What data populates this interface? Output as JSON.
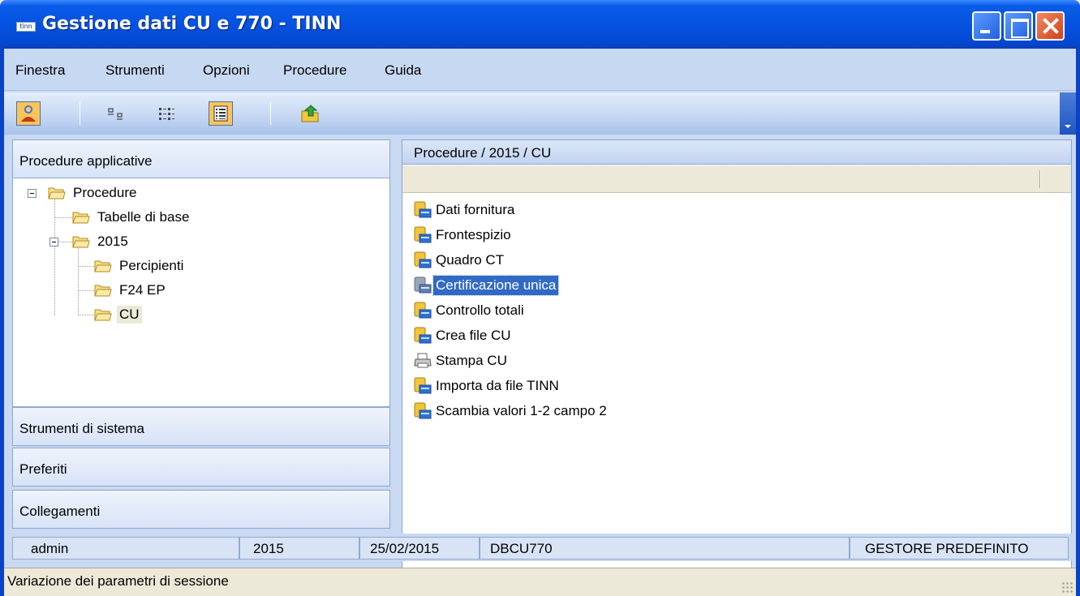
{
  "window": {
    "title": "Gestione dati CU e 770 - TINN",
    "app_icon_text": "tinn"
  },
  "menu": [
    "Finestra",
    "Strumenti",
    "Opzioni",
    "Procedure",
    "Guida"
  ],
  "toolbar": {
    "buttons": [
      "user-icon",
      "small-icons-view-icon",
      "list-view-icon",
      "details-view-icon",
      "export-icon"
    ],
    "active": [
      "user-icon",
      "details-view-icon"
    ]
  },
  "left_panel": {
    "header": "Procedure applicative",
    "tree": [
      {
        "label": "Procedure",
        "expanded": true
      },
      {
        "label": "Tabelle di base"
      },
      {
        "label": "2015",
        "expanded": true
      },
      {
        "label": "Percipienti"
      },
      {
        "label": "F24 EP"
      },
      {
        "label": "CU",
        "selected": true
      }
    ],
    "groups": [
      "Strumenti di sistema",
      "Preferiti",
      "Collegamenti"
    ]
  },
  "right_panel": {
    "breadcrumb": "Procedure / 2015 / CU",
    "items": [
      {
        "label": "Dati fornitura",
        "icon": "procedure-icon"
      },
      {
        "label": "Frontespizio",
        "icon": "procedure-icon"
      },
      {
        "label": "Quadro CT",
        "icon": "procedure-icon"
      },
      {
        "label": "Certificazione unica",
        "icon": "procedure-icon",
        "selected": true
      },
      {
        "label": "Controllo totali",
        "icon": "procedure-icon"
      },
      {
        "label": "Crea file CU",
        "icon": "procedure-icon"
      },
      {
        "label": "Stampa CU",
        "icon": "printer-icon"
      },
      {
        "label": "Importa da file TINN",
        "icon": "procedure-icon"
      },
      {
        "label": "Scambia valori 1-2 campo 2",
        "icon": "procedure-icon"
      }
    ]
  },
  "status": {
    "user": "admin",
    "year": "2015",
    "date": "25/02/2015",
    "database": "DBCU770",
    "manager": "GESTORE PREDEFINITO"
  },
  "message": "Variazione dei parametri di sessione",
  "colors": {
    "titlebar": "#0552e0",
    "selection": "#316ac5",
    "panel_bg": "#c9d9f1"
  }
}
